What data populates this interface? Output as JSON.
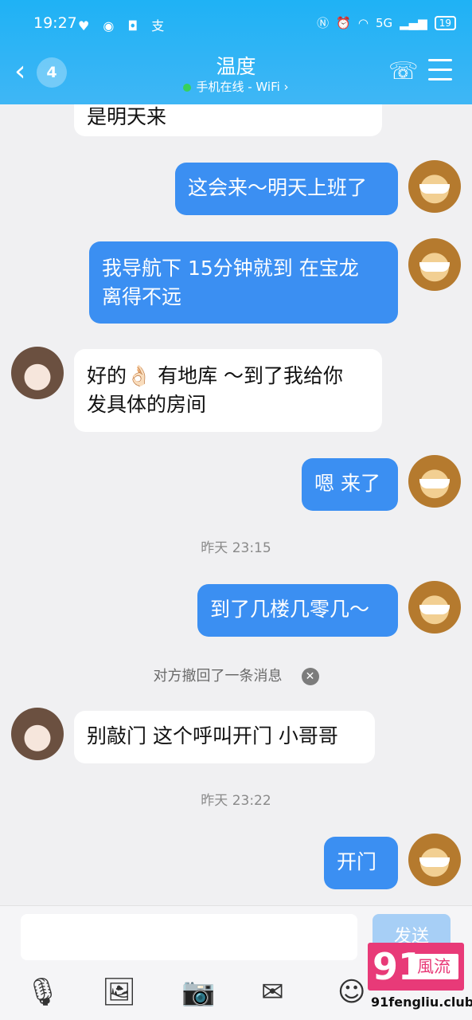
{
  "status_bar": {
    "time": "19:27",
    "network": "5G",
    "battery": "19"
  },
  "header": {
    "unread": "4",
    "title": "温度",
    "status": "手机在线 - WiFi ›"
  },
  "messages": [
    {
      "side": "in",
      "text": "是明天来"
    },
    {
      "side": "out",
      "text": "这会来～明天上班了"
    },
    {
      "side": "out",
      "line1": "我导航下 15分钟就到 在宝龙",
      "line2": "离得不远"
    },
    {
      "side": "in",
      "line1": "好的👌🏻 有地库 ～到了我给你",
      "line2": "发具体的房间"
    },
    {
      "side": "out",
      "text": "嗯 来了"
    },
    {
      "type": "time",
      "text": "昨天 23:15"
    },
    {
      "side": "out",
      "text": "到了几楼几零几～"
    },
    {
      "type": "revoke",
      "text": "对方撤回了一条消息"
    },
    {
      "side": "in",
      "text": "别敲门 这个呼叫开门 小哥哥"
    },
    {
      "type": "time",
      "text": "昨天 23:22"
    },
    {
      "side": "out",
      "text": "开门"
    }
  ],
  "input": {
    "send_label": "发送"
  },
  "watermark": {
    "num": "91",
    "brand": "風流",
    "url": "91fengliu.club"
  }
}
